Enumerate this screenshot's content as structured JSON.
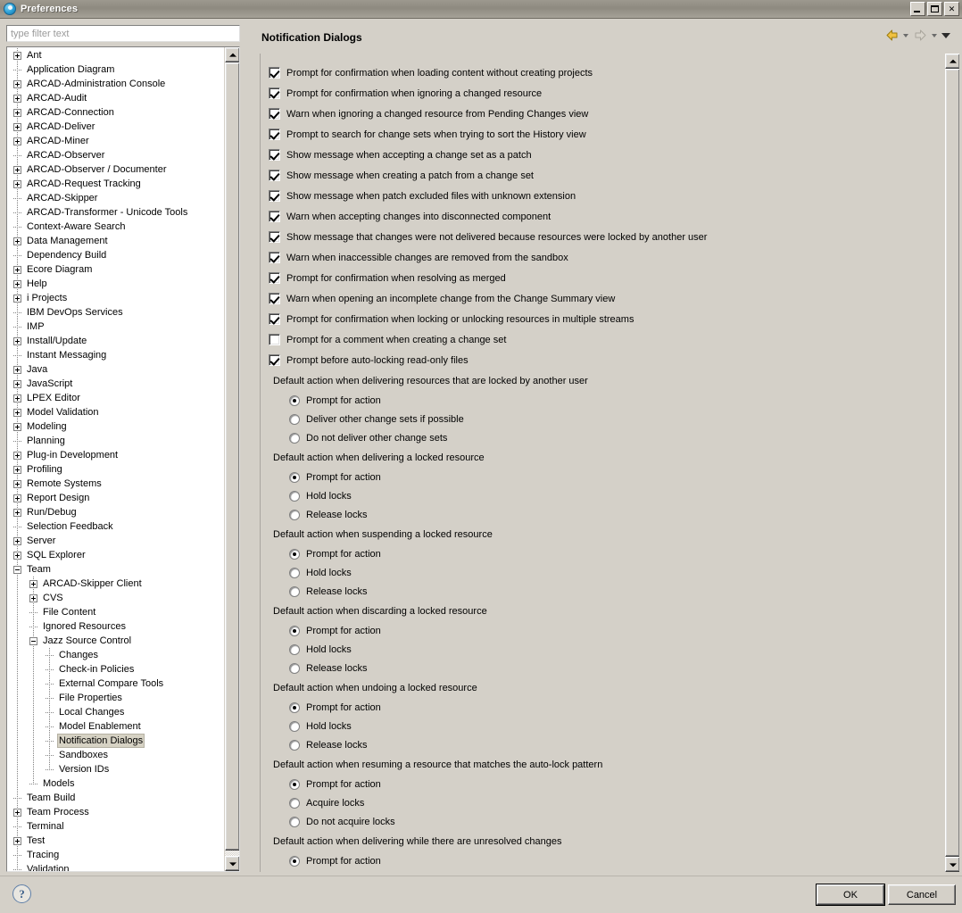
{
  "window": {
    "title": "Preferences",
    "icon": "preferences-icon",
    "controls": {
      "minimize": "minimize-icon",
      "maximize": "maximize-icon",
      "close": "close-icon"
    }
  },
  "filter": {
    "placeholder": "type filter text",
    "value": ""
  },
  "tree": {
    "items": [
      {
        "label": "Ant",
        "depth": 0,
        "toggle": "plus"
      },
      {
        "label": "Application Diagram",
        "depth": 0,
        "toggle": "leaf"
      },
      {
        "label": "ARCAD-Administration Console",
        "depth": 0,
        "toggle": "plus"
      },
      {
        "label": "ARCAD-Audit",
        "depth": 0,
        "toggle": "plus"
      },
      {
        "label": "ARCAD-Connection",
        "depth": 0,
        "toggle": "plus"
      },
      {
        "label": "ARCAD-Deliver",
        "depth": 0,
        "toggle": "plus"
      },
      {
        "label": "ARCAD-Miner",
        "depth": 0,
        "toggle": "plus"
      },
      {
        "label": "ARCAD-Observer",
        "depth": 0,
        "toggle": "leaf"
      },
      {
        "label": "ARCAD-Observer / Documenter",
        "depth": 0,
        "toggle": "plus"
      },
      {
        "label": "ARCAD-Request Tracking",
        "depth": 0,
        "toggle": "plus"
      },
      {
        "label": "ARCAD-Skipper",
        "depth": 0,
        "toggle": "leaf"
      },
      {
        "label": "ARCAD-Transformer - Unicode Tools",
        "depth": 0,
        "toggle": "leaf"
      },
      {
        "label": "Context-Aware Search",
        "depth": 0,
        "toggle": "leaf"
      },
      {
        "label": "Data Management",
        "depth": 0,
        "toggle": "plus"
      },
      {
        "label": "Dependency Build",
        "depth": 0,
        "toggle": "leaf"
      },
      {
        "label": "Ecore Diagram",
        "depth": 0,
        "toggle": "plus"
      },
      {
        "label": "Help",
        "depth": 0,
        "toggle": "plus"
      },
      {
        "label": "i Projects",
        "depth": 0,
        "toggle": "plus"
      },
      {
        "label": "IBM DevOps Services",
        "depth": 0,
        "toggle": "leaf"
      },
      {
        "label": "IMP",
        "depth": 0,
        "toggle": "leaf"
      },
      {
        "label": "Install/Update",
        "depth": 0,
        "toggle": "plus"
      },
      {
        "label": "Instant Messaging",
        "depth": 0,
        "toggle": "leaf"
      },
      {
        "label": "Java",
        "depth": 0,
        "toggle": "plus"
      },
      {
        "label": "JavaScript",
        "depth": 0,
        "toggle": "plus"
      },
      {
        "label": "LPEX Editor",
        "depth": 0,
        "toggle": "plus"
      },
      {
        "label": "Model Validation",
        "depth": 0,
        "toggle": "plus"
      },
      {
        "label": "Modeling",
        "depth": 0,
        "toggle": "plus"
      },
      {
        "label": "Planning",
        "depth": 0,
        "toggle": "leaf"
      },
      {
        "label": "Plug-in Development",
        "depth": 0,
        "toggle": "plus"
      },
      {
        "label": "Profiling",
        "depth": 0,
        "toggle": "plus"
      },
      {
        "label": "Remote Systems",
        "depth": 0,
        "toggle": "plus"
      },
      {
        "label": "Report Design",
        "depth": 0,
        "toggle": "plus"
      },
      {
        "label": "Run/Debug",
        "depth": 0,
        "toggle": "plus"
      },
      {
        "label": "Selection Feedback",
        "depth": 0,
        "toggle": "leaf"
      },
      {
        "label": "Server",
        "depth": 0,
        "toggle": "plus"
      },
      {
        "label": "SQL Explorer",
        "depth": 0,
        "toggle": "plus"
      },
      {
        "label": "Team",
        "depth": 0,
        "toggle": "minus"
      },
      {
        "label": "ARCAD-Skipper Client",
        "depth": 1,
        "toggle": "plus"
      },
      {
        "label": "CVS",
        "depth": 1,
        "toggle": "plus"
      },
      {
        "label": "File Content",
        "depth": 1,
        "toggle": "leaf"
      },
      {
        "label": "Ignored Resources",
        "depth": 1,
        "toggle": "leaf"
      },
      {
        "label": "Jazz Source Control",
        "depth": 1,
        "toggle": "minus"
      },
      {
        "label": "Changes",
        "depth": 2,
        "toggle": "leaf"
      },
      {
        "label": "Check-in Policies",
        "depth": 2,
        "toggle": "leaf"
      },
      {
        "label": "External Compare Tools",
        "depth": 2,
        "toggle": "leaf"
      },
      {
        "label": "File Properties",
        "depth": 2,
        "toggle": "leaf"
      },
      {
        "label": "Local Changes",
        "depth": 2,
        "toggle": "leaf"
      },
      {
        "label": "Model Enablement",
        "depth": 2,
        "toggle": "leaf"
      },
      {
        "label": "Notification Dialogs",
        "depth": 2,
        "toggle": "leaf",
        "selected": true
      },
      {
        "label": "Sandboxes",
        "depth": 2,
        "toggle": "leaf"
      },
      {
        "label": "Version IDs",
        "depth": 2,
        "toggle": "leaf"
      },
      {
        "label": "Models",
        "depth": 1,
        "toggle": "leaf"
      },
      {
        "label": "Team Build",
        "depth": 0,
        "toggle": "leaf"
      },
      {
        "label": "Team Process",
        "depth": 0,
        "toggle": "plus"
      },
      {
        "label": "Terminal",
        "depth": 0,
        "toggle": "leaf"
      },
      {
        "label": "Test",
        "depth": 0,
        "toggle": "plus"
      },
      {
        "label": "Tracing",
        "depth": 0,
        "toggle": "leaf"
      },
      {
        "label": "Validation",
        "depth": 0,
        "toggle": "leaf"
      }
    ]
  },
  "page": {
    "title": "Notification Dialogs",
    "toolbar": {
      "back": "back-arrow-icon",
      "back_menu": "back-dropdown-icon",
      "forward": "forward-arrow-icon",
      "forward_menu": "forward-dropdown-icon",
      "view_menu": "view-menu-icon",
      "back_color": "#e8b23a",
      "forward_color": "#c9c5bb"
    },
    "checkboxes": [
      {
        "label": "Prompt for confirmation when loading content without creating projects",
        "checked": true
      },
      {
        "label": "Prompt for confirmation when ignoring a changed resource",
        "checked": true
      },
      {
        "label": "Warn when ignoring a changed resource from Pending Changes view",
        "checked": true
      },
      {
        "label": "Prompt to search for change sets when trying to sort the History view",
        "checked": true
      },
      {
        "label": "Show message when accepting a change set as a patch",
        "checked": true
      },
      {
        "label": "Show message when creating a patch from a change set",
        "checked": true
      },
      {
        "label": "Show message when patch excluded files with unknown extension",
        "checked": true
      },
      {
        "label": "Warn when accepting changes into disconnected component",
        "checked": true
      },
      {
        "label": "Show message that changes were not delivered because resources were locked by another user",
        "checked": true
      },
      {
        "label": "Warn when inaccessible changes are removed from the sandbox",
        "checked": true
      },
      {
        "label": "Prompt for confirmation when resolving as merged",
        "checked": true
      },
      {
        "label": "Warn when opening an incomplete change from the Change Summary view",
        "checked": true
      },
      {
        "label": "Prompt for confirmation when locking or unlocking resources in multiple streams",
        "checked": true
      },
      {
        "label": "Prompt for a comment when creating a change set",
        "checked": false
      },
      {
        "label": "Prompt before auto-locking read-only files",
        "checked": true
      }
    ],
    "radio_groups": [
      {
        "label": "Default action when delivering resources that are locked by another user",
        "options": [
          {
            "label": "Prompt for action",
            "selected": true
          },
          {
            "label": "Deliver other change sets if possible",
            "selected": false
          },
          {
            "label": "Do not deliver other change sets",
            "selected": false
          }
        ]
      },
      {
        "label": "Default action when delivering a locked resource",
        "options": [
          {
            "label": "Prompt for action",
            "selected": true
          },
          {
            "label": "Hold locks",
            "selected": false
          },
          {
            "label": "Release locks",
            "selected": false
          }
        ]
      },
      {
        "label": "Default action when suspending a locked resource",
        "options": [
          {
            "label": "Prompt for action",
            "selected": true
          },
          {
            "label": "Hold locks",
            "selected": false
          },
          {
            "label": "Release locks",
            "selected": false
          }
        ]
      },
      {
        "label": "Default action when discarding a locked resource",
        "options": [
          {
            "label": "Prompt for action",
            "selected": true
          },
          {
            "label": "Hold locks",
            "selected": false
          },
          {
            "label": "Release locks",
            "selected": false
          }
        ]
      },
      {
        "label": "Default action when undoing a locked resource",
        "options": [
          {
            "label": "Prompt for action",
            "selected": true
          },
          {
            "label": "Hold locks",
            "selected": false
          },
          {
            "label": "Release locks",
            "selected": false
          }
        ]
      },
      {
        "label": "Default action when resuming a resource that matches the auto-lock pattern",
        "options": [
          {
            "label": "Prompt for action",
            "selected": true
          },
          {
            "label": "Acquire locks",
            "selected": false
          },
          {
            "label": "Do not acquire locks",
            "selected": false
          }
        ]
      },
      {
        "label": "Default action when delivering while there are unresolved changes",
        "options": [
          {
            "label": "Prompt for action",
            "selected": true
          }
        ]
      }
    ]
  },
  "footer": {
    "help": "help-icon",
    "ok_label": "OK",
    "cancel_label": "Cancel"
  }
}
